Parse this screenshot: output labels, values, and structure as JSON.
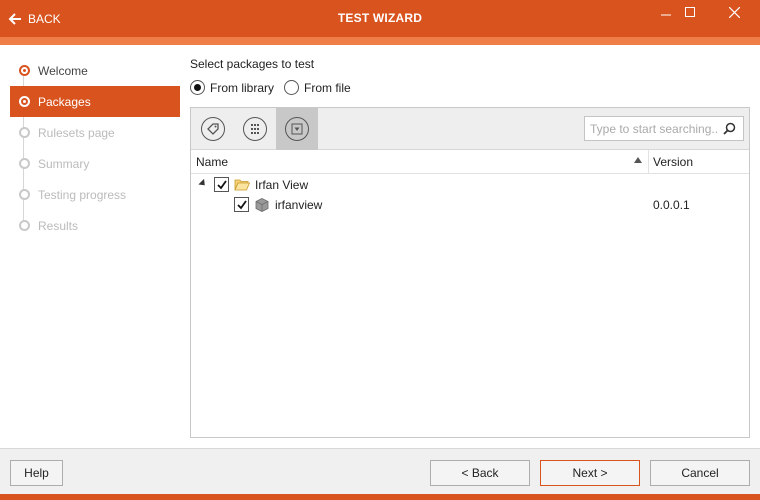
{
  "window": {
    "title": "TEST WIZARD",
    "back_label": "BACK",
    "accent_color": "#d9531e"
  },
  "sidebar": {
    "steps": [
      {
        "label": "Welcome",
        "state": "done"
      },
      {
        "label": "Packages",
        "state": "active"
      },
      {
        "label": "Rulesets page",
        "state": "pending"
      },
      {
        "label": "Summary",
        "state": "pending"
      },
      {
        "label": "Testing progress",
        "state": "pending"
      },
      {
        "label": "Results",
        "state": "pending"
      }
    ]
  },
  "main": {
    "heading": "Select packages to test",
    "source_options": [
      {
        "label": "From library",
        "selected": true
      },
      {
        "label": "From file",
        "selected": false
      }
    ],
    "toolbar": {
      "buttons": [
        {
          "icon": "tag-icon",
          "active": false
        },
        {
          "icon": "grid-icon",
          "active": false
        },
        {
          "icon": "filter-icon",
          "active": true
        }
      ],
      "search_placeholder": "Type to start searching..."
    },
    "table": {
      "columns": [
        "Name",
        "Version"
      ],
      "rows": [
        {
          "name": "Irfan View",
          "version": "",
          "checked": true,
          "type": "folder",
          "expanded": true
        },
        {
          "name": "irfanview",
          "version": "0.0.0.1",
          "checked": true,
          "type": "package"
        }
      ]
    }
  },
  "footer": {
    "help_label": "Help",
    "back_label": "< Back",
    "next_label": "Next >",
    "cancel_label": "Cancel"
  }
}
